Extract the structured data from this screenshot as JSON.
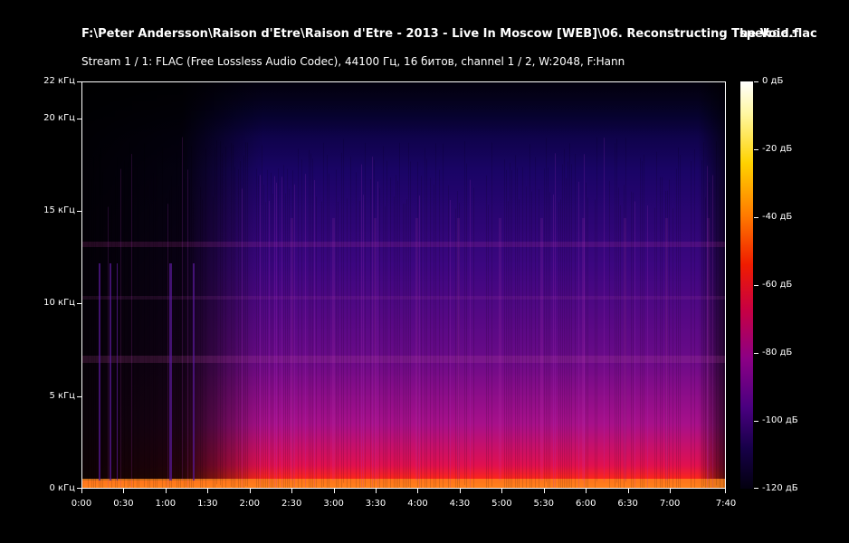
{
  "title": "F:\\Peter Andersson\\Raison d'Etre\\Raison d'Etre - 2013 - Live In Moscow [WEB]\\06. Reconstructing The Void.flac",
  "app_name": "spek",
  "app_version": "0.8.5",
  "stream_info": "Stream 1 / 1: FLAC (Free Lossless Audio Codec), 44100 Гц, 16 битов, channel 1 / 2, W:2048, F:Hann",
  "freq_axis": {
    "labels": [
      "22 кГц",
      "20 кГц",
      "15 кГц",
      "10 кГц",
      "5 кГц",
      "0 кГц"
    ],
    "values_khz": [
      22,
      20,
      15,
      10,
      5,
      0
    ],
    "max_khz": 22
  },
  "time_axis": {
    "labels": [
      "0:00",
      "0:30",
      "1:00",
      "1:30",
      "2:00",
      "2:30",
      "3:00",
      "3:30",
      "4:00",
      "4:30",
      "5:00",
      "5:30",
      "6:00",
      "6:30",
      "7:00",
      "7:40"
    ],
    "values_sec": [
      0,
      30,
      60,
      90,
      120,
      150,
      180,
      210,
      240,
      270,
      300,
      330,
      360,
      390,
      420,
      460
    ],
    "max_sec": 460
  },
  "db_scale": {
    "labels": [
      "0 дБ",
      "-20 дБ",
      "-40 дБ",
      "-60 дБ",
      "-80 дБ",
      "-100 дБ",
      "-120 дБ"
    ],
    "values_db": [
      0,
      -20,
      -40,
      -60,
      -80,
      -100,
      -120
    ],
    "min_db": -120,
    "max_db": 0
  },
  "colors": {
    "background": "#000000",
    "text": "#ffffff",
    "spectrum_low": "#05001a",
    "spectrum_mid": "#6a0a8a",
    "spectrum_high": "#ff4400"
  }
}
